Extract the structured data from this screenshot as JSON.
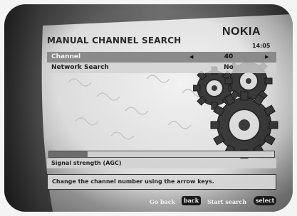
{
  "screen": {
    "title": "MANUAL CHANNEL SEARCH",
    "brand": "NOKIA",
    "clock": "14:05"
  },
  "rows": [
    {
      "label": "Channel",
      "value": "40",
      "selected": true
    },
    {
      "label": "Network Search",
      "value": "No",
      "selected": false
    }
  ],
  "signal": {
    "label": "Signal strength (AGC)",
    "level_percent": 17
  },
  "help": {
    "text": "Change the channel number using the arrow keys."
  },
  "footer": {
    "back_label": "Go back",
    "back_key": "back",
    "start_label": "Start search",
    "start_key": "select"
  },
  "colors": {
    "selected_row": "#8a8a8a",
    "row": "#d2d2d2",
    "signal_fill": "#6c6c6c"
  },
  "icons": {
    "left_arrow": "arrow-left-icon",
    "right_arrow": "arrow-right-icon",
    "gears": "gears-decoration"
  }
}
